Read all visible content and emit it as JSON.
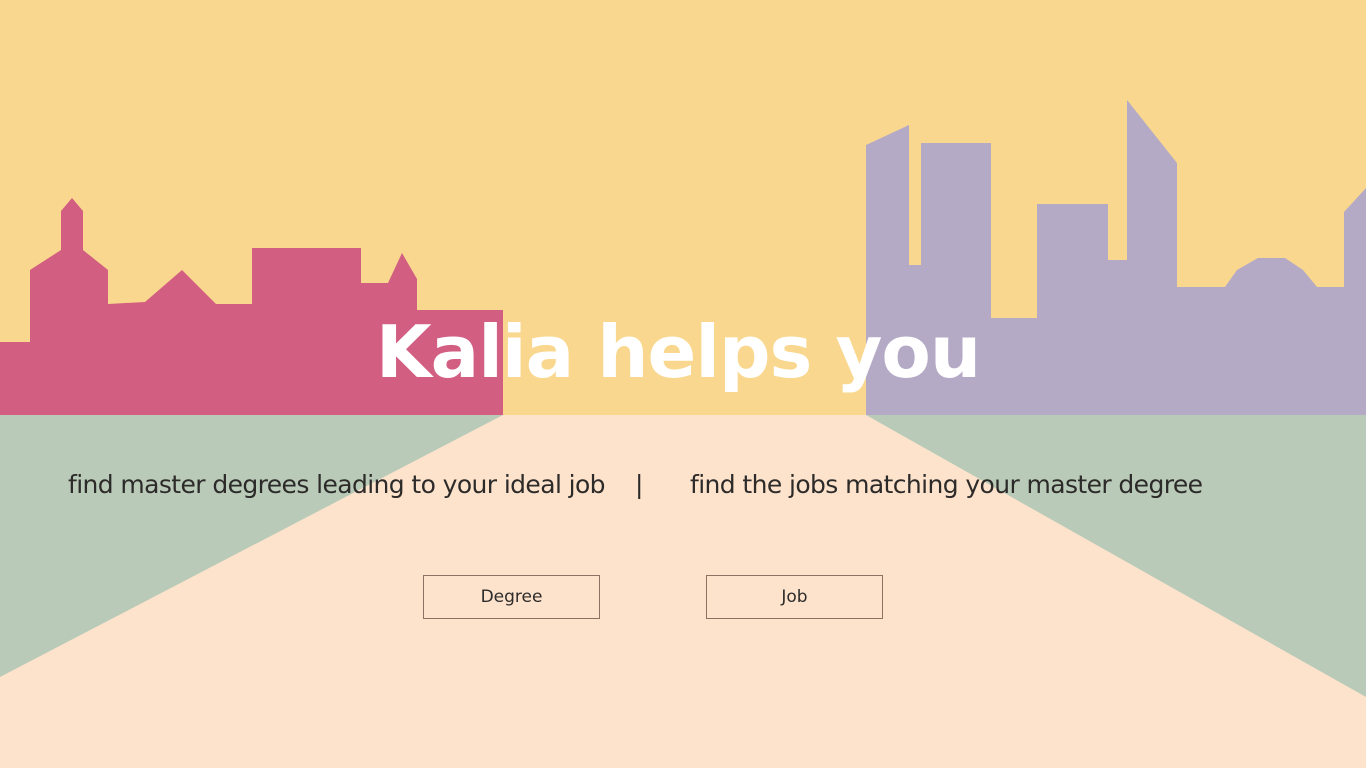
{
  "hero": {
    "title": "Kalia helps you"
  },
  "taglines": {
    "degree_to_job": "find master degrees leading to your ideal job",
    "separator": "|",
    "job_to_degree": "find the jobs matching your master degree"
  },
  "buttons": {
    "degree_label": "Degree",
    "job_label": "Job"
  },
  "colors": {
    "sky": "#f9d78e",
    "road": "#fde3cc",
    "grass": "#b9cbb8",
    "old_town": "#d25e82",
    "modern_city": "#b4aac6",
    "title_text": "#ffffff",
    "body_text": "#2d2b2a",
    "button_border": "#8c7263"
  }
}
